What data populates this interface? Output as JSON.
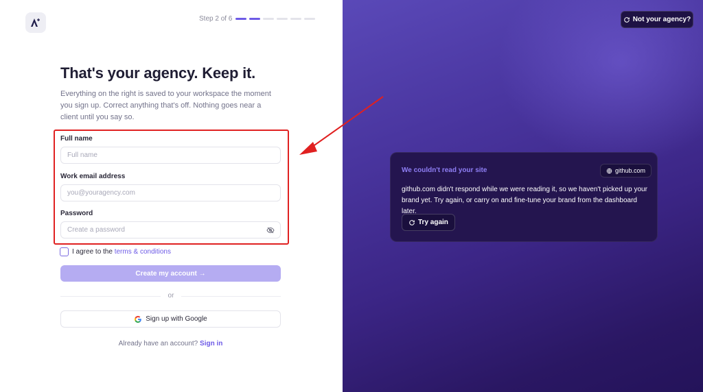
{
  "stepper": {
    "label": "Step 2 of 6",
    "current_step": 2,
    "total_steps": 6
  },
  "hero": {
    "title": "That's your agency. Keep it.",
    "intro": "Everything on the right is saved to your workspace the moment you sign up. Correct anything that's off. Nothing goes near a client until you say so."
  },
  "form": {
    "full_name": {
      "label": "Full name",
      "placeholder": "Full name",
      "value": ""
    },
    "email": {
      "label": "Work email address",
      "placeholder": "you@youragency.com",
      "value": ""
    },
    "password": {
      "label": "Password",
      "placeholder": "Create a password",
      "value": ""
    },
    "terms": {
      "prefix": "I agree to the ",
      "link": "terms & conditions",
      "checked": false
    },
    "create_label": "Create my account →",
    "divider_text": "or",
    "google_label": "Sign up with Google",
    "signin_prompt": "Already have an account?",
    "signin_link": "Sign in"
  },
  "right_panel": {
    "not_agency_label": "Not your agency?",
    "card": {
      "title": "We couldn't read your site",
      "site_chip": "github.com",
      "message": "github.com didn't respond while we were reading it, so we haven't picked up your brand yet. Try again, or carry on and fine-tune your brand from the dashboard later.",
      "retry_label": "Try again"
    }
  },
  "icons": {
    "logo": "app-logo-icon",
    "password_toggle": "eye-off-icon",
    "google": "google-icon",
    "refresh": "refresh-icon",
    "globe": "globe-icon"
  },
  "colors": {
    "accent": "#6d5ae6",
    "button_disabled": "#b5acf2",
    "panel_gradient_start": "#5a49b8",
    "panel_gradient_end": "#24135a",
    "card_bg": "#24154f",
    "annotation_red": "#e02020"
  }
}
